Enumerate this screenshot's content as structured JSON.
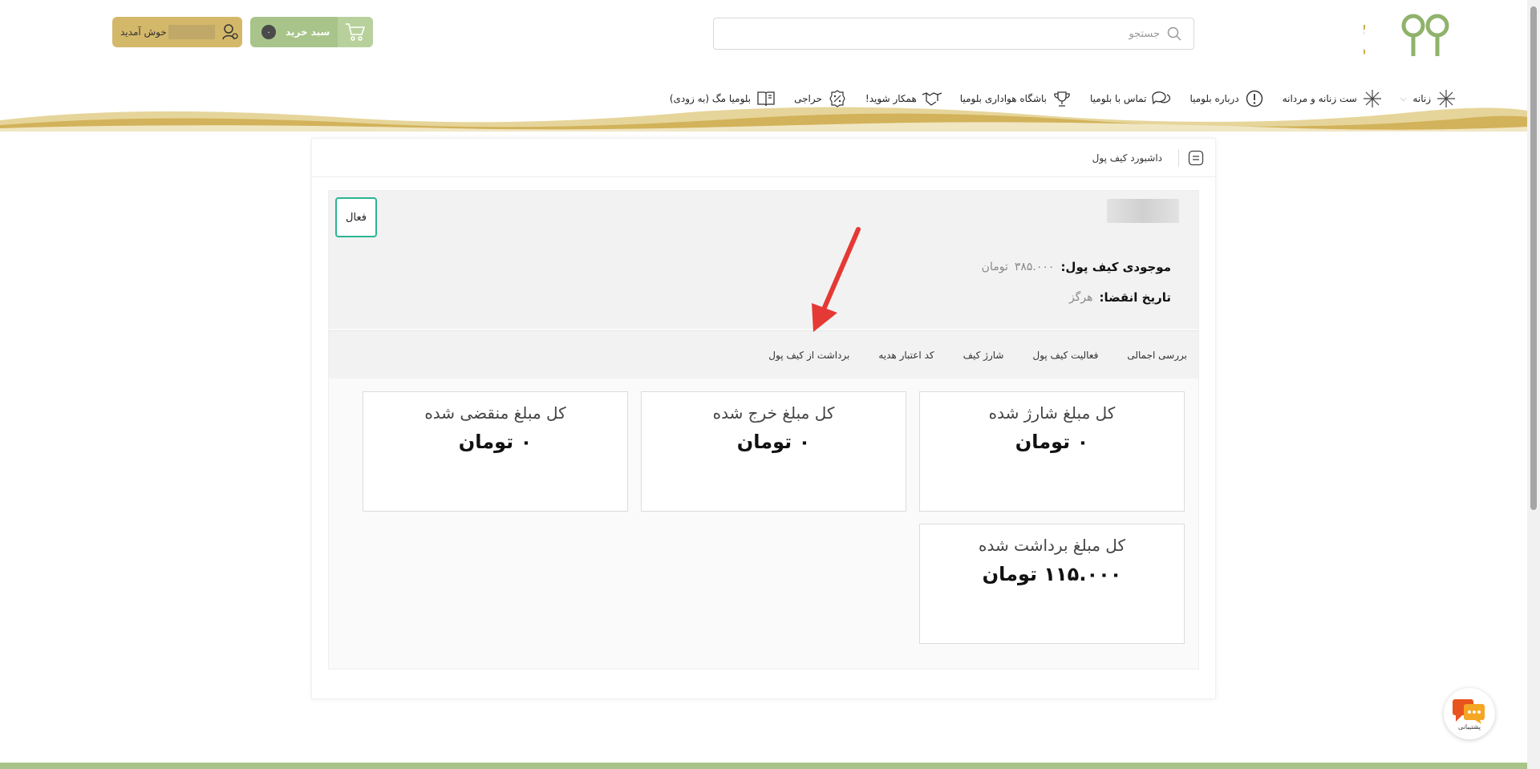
{
  "header": {
    "search_placeholder": "جستجو",
    "cart_label": "سبد خرید",
    "cart_count": "۰",
    "welcome_label": "خوش آمدید"
  },
  "nav": {
    "items": [
      {
        "label": "زنانه",
        "icon": "star-burst-icon",
        "has_dropdown": true
      },
      {
        "label": "ست زنانه و مردانه",
        "icon": "star-burst-icon"
      },
      {
        "label": "درباره بلومیا",
        "icon": "info-circle-icon"
      },
      {
        "label": "تماس با بلومیا",
        "icon": "chat-bubbles-icon"
      },
      {
        "label": "باشگاه هواداری بلومیا",
        "icon": "trophy-icon"
      },
      {
        "label": "همکار شوید!",
        "icon": "handshake-icon"
      },
      {
        "label": "حراجی",
        "icon": "discount-badge-icon"
      },
      {
        "label": "بلومیا مگ (به زودی)",
        "icon": "open-book-icon"
      }
    ]
  },
  "panel": {
    "title": "داشبورد کیف پول",
    "status": "فعال",
    "balance_label": "موجودی کیف پول:",
    "balance_value": "۳۸۵.۰۰۰",
    "balance_unit": "تومان",
    "expiry_label": "تاریخ انقضا:",
    "expiry_value": "هرگز",
    "tabs": [
      "بررسی اجمالی",
      "فعالیت کیف پول",
      "شارژ کیف",
      "کد اعتبار هدیه",
      "برداشت از کیف پول"
    ],
    "stats": [
      {
        "label": "کل مبلغ شارژ شده",
        "value": "۰ تومان"
      },
      {
        "label": "کل مبلغ خرج شده",
        "value": "۰ تومان"
      },
      {
        "label": "کل مبلغ منقضی شده",
        "value": "۰ تومان"
      },
      {
        "label": "کل مبلغ برداشت شده",
        "value": "۱۱۵.۰۰۰ تومان"
      }
    ]
  },
  "support": {
    "label": "پشتیبانی"
  },
  "colors": {
    "cart_green": "#a8c48a",
    "user_gold": "#d4b86a",
    "status_teal": "#2bb494",
    "arrow_red": "#e53935",
    "logo_gold": "#c9a94a",
    "logo_green": "#8fb36a"
  }
}
